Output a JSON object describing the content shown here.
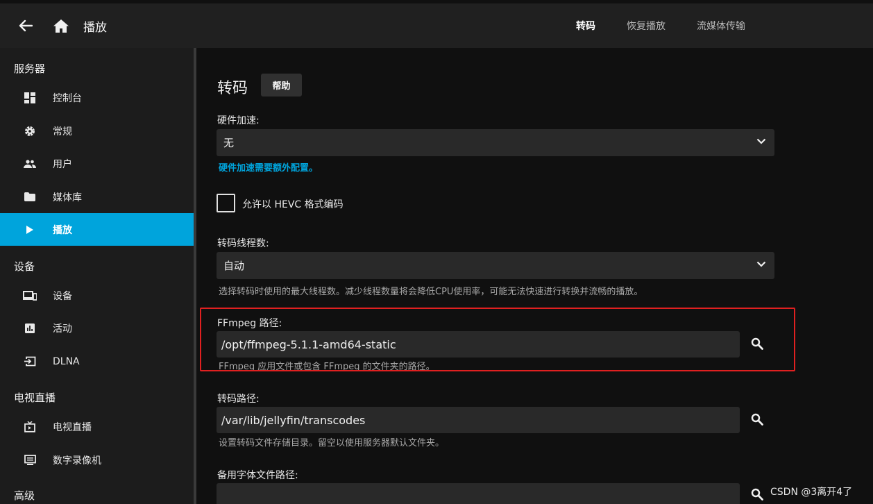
{
  "header": {
    "title": "播放",
    "tabs": [
      {
        "label": "转码",
        "active": true
      },
      {
        "label": "恢复播放",
        "active": false
      },
      {
        "label": "流媒体传输",
        "active": false
      }
    ]
  },
  "sidebar": {
    "sections": [
      {
        "title": "服务器",
        "items": [
          {
            "label": "控制台",
            "icon": "dashboard-icon"
          },
          {
            "label": "常规",
            "icon": "gear-icon"
          },
          {
            "label": "用户",
            "icon": "users-icon"
          },
          {
            "label": "媒体库",
            "icon": "folder-icon"
          },
          {
            "label": "播放",
            "icon": "play-icon",
            "active": true
          }
        ]
      },
      {
        "title": "设备",
        "items": [
          {
            "label": "设备",
            "icon": "devices-icon"
          },
          {
            "label": "活动",
            "icon": "activity-icon"
          },
          {
            "label": "DLNA",
            "icon": "input-icon"
          }
        ]
      },
      {
        "title": "电视直播",
        "items": [
          {
            "label": "电视直播",
            "icon": "live-tv-icon"
          },
          {
            "label": "数字录像机",
            "icon": "dvr-icon"
          }
        ]
      },
      {
        "title": "高级",
        "items": []
      }
    ]
  },
  "main": {
    "title": "转码",
    "help_label": "帮助",
    "hw_accel": {
      "label": "硬件加速:",
      "value": "无",
      "link": "硬件加速需要额外配置。"
    },
    "hevc_checkbox": {
      "label": "允许以 HEVC 格式编码",
      "checked": false
    },
    "threads": {
      "label": "转码线程数:",
      "value": "自动",
      "hint": "选择转码时使用的最大线程数。减少线程数量将会降低CPU使用率，可能无法快速进行转换并流畅的播放。"
    },
    "ffmpeg": {
      "label": "FFmpeg 路径:",
      "value": "/opt/ffmpeg-5.1.1-amd64-static",
      "hint": "FFmpeg 应用文件或包含 FFmpeg 的文件夹的路径。"
    },
    "transcode_path": {
      "label": "转码路径:",
      "value": "/var/lib/jellyfin/transcodes",
      "hint": "设置转码文件存储目录。留空以使用服务器默认文件夹。"
    },
    "fallback_font": {
      "label": "备用字体文件路径:",
      "value": ""
    }
  },
  "watermark": "CSDN @3离开4了",
  "colors": {
    "accent": "#00a4dc",
    "highlight": "#e02020"
  }
}
